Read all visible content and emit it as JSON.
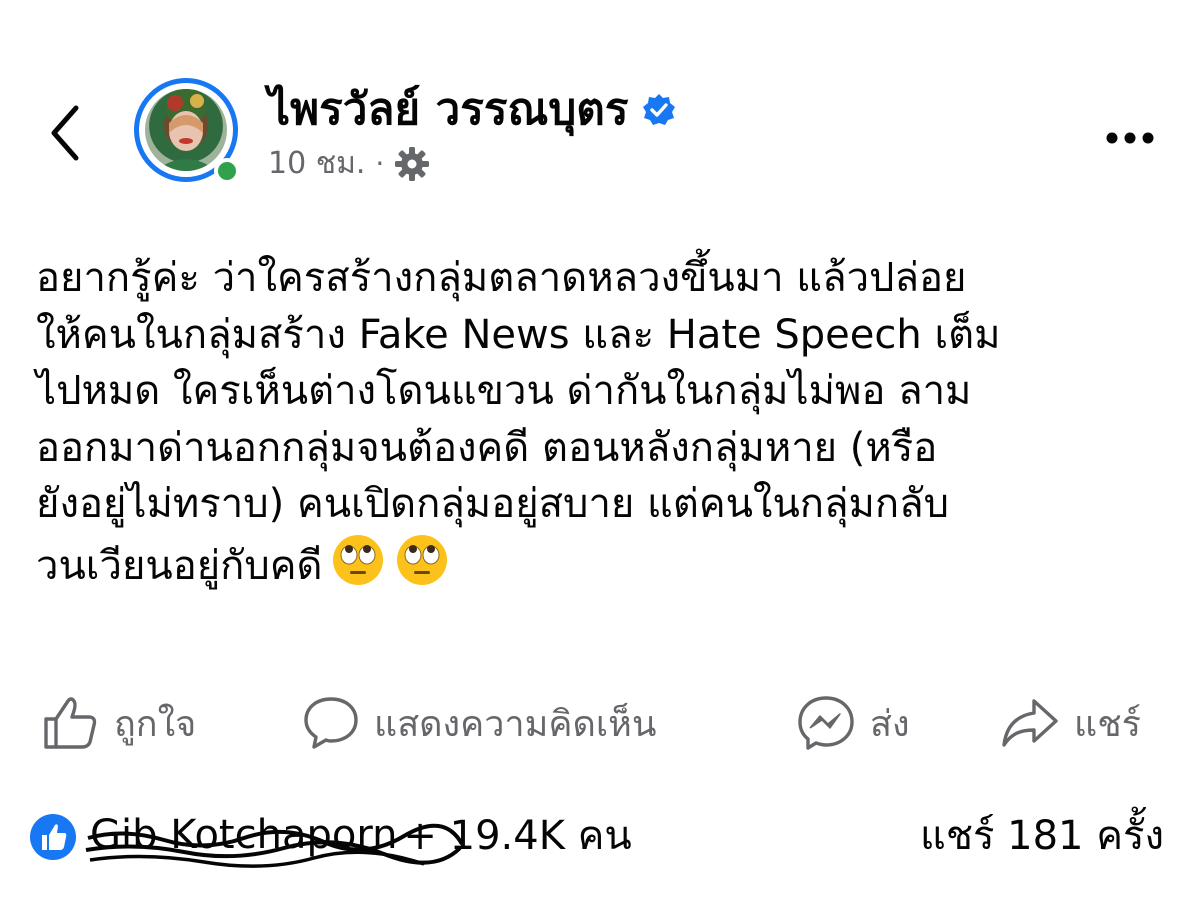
{
  "post": {
    "author": "ไพรวัลย์ วรรณบุตร",
    "time": "10 ชม.",
    "separator": "·",
    "lines": [
      "อยากรู้ค่ะ ว่าใครสร้างกลุ่มตลาดหลวงขึ้นมา แล้วปล่อย",
      "ให้คนในกลุ่มสร้าง Fake News และ Hate Speech เต็ม",
      "ไปหมด ใครเห็นต่างโดนแขวน ด่ากันในกลุ่มไม่พอ ลาม",
      "ออกมาด่านอกกลุ่มจนต้องคดี ตอนหลังกลุ่มหาย (หรือ",
      "ยังอยู่ไม่ทราบ)  คนเปิดกลุ่มอยู่สบาย แต่คนในกลุ่มกลับ",
      "วนเวียนอยู่กับคดี"
    ]
  },
  "actions": {
    "like": "ถูกใจ",
    "comment": "แสดงความคิดเห็น",
    "send": "ส่ง",
    "share": "แชร์"
  },
  "summary": {
    "reactor_name": "Gib Kotchaporn",
    "reactor_more": "+ 19.4K คน",
    "shares": "แชร์ 181 ครั้ง"
  },
  "colors": {
    "accent": "#1877f2",
    "online": "#31a24c",
    "muted": "#65676b",
    "text": "#050505"
  },
  "icons": {
    "back": "chevron-left-icon",
    "verified": "verified-badge-icon",
    "privacy": "gear-icon",
    "more": "more-dots-icon",
    "like": "thumbs-up-icon",
    "comment": "comment-bubble-icon",
    "send": "messenger-icon",
    "share": "share-arrow-icon",
    "like_badge": "like-reaction-icon",
    "emoji": "rolling-eyes-emoji"
  }
}
